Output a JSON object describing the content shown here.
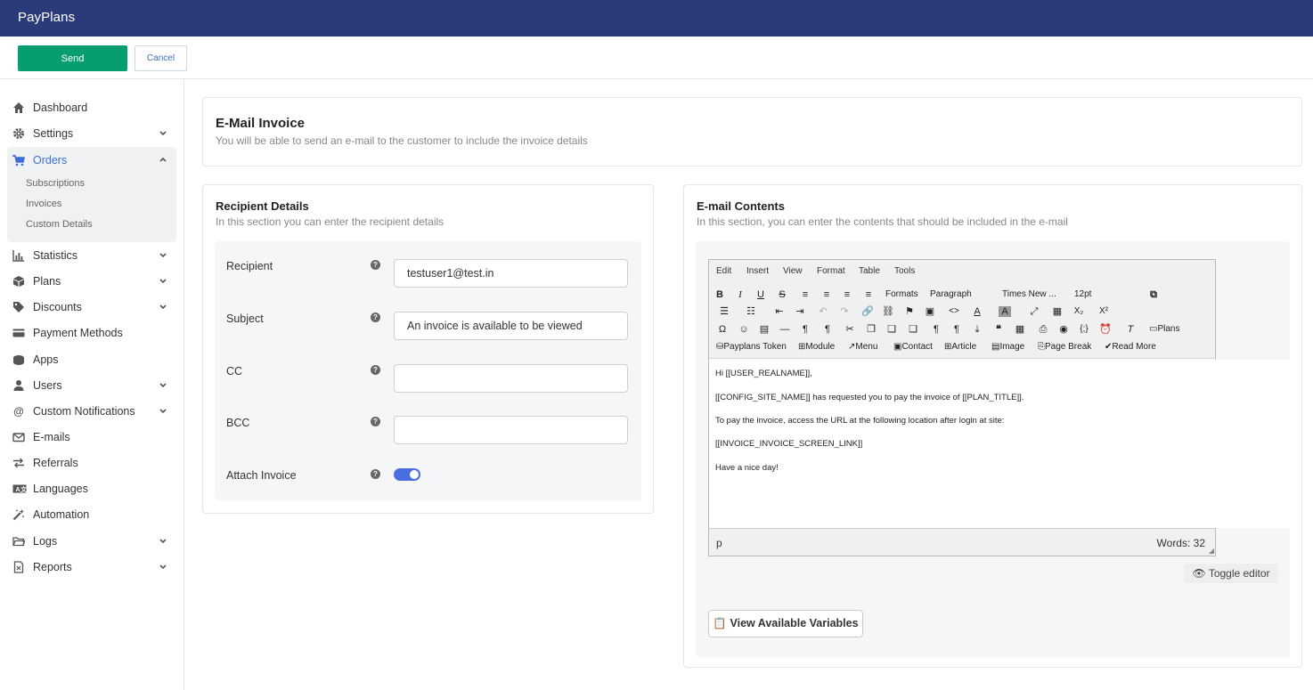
{
  "app": {
    "title": "PayPlans"
  },
  "actions": {
    "send_label": "Send",
    "cancel_label": "Cancel"
  },
  "sidebar": {
    "items": [
      {
        "label": "Dashboard",
        "icon": "home-icon"
      },
      {
        "label": "Settings",
        "icon": "gear-icon"
      },
      {
        "label": "Orders",
        "icon": "cart-icon"
      },
      {
        "label": "Statistics",
        "icon": "bar-chart-icon"
      },
      {
        "label": "Plans",
        "icon": "boxes-icon"
      },
      {
        "label": "Discounts",
        "icon": "tag-icon"
      },
      {
        "label": "Payment Methods",
        "icon": "credit-card-icon"
      },
      {
        "label": "Apps",
        "icon": "cubes-icon"
      },
      {
        "label": "Users",
        "icon": "user-icon"
      },
      {
        "label": "Custom Notifications",
        "icon": "at-icon"
      },
      {
        "label": "E-mails",
        "icon": "envelope-icon"
      },
      {
        "label": "Referrals",
        "icon": "exchange-icon"
      },
      {
        "label": "Languages",
        "icon": "language-icon"
      },
      {
        "label": "Automation",
        "icon": "magic-icon"
      },
      {
        "label": "Logs",
        "icon": "folder-icon"
      },
      {
        "label": "Reports",
        "icon": "file-excel-icon"
      }
    ],
    "orders_sub": [
      "Subscriptions",
      "Invoices",
      "Custom Details"
    ]
  },
  "header_card": {
    "title": "E-Mail Invoice",
    "subtitle": "You will be able to send an e-mail to the customer to include the invoice details"
  },
  "recipient": {
    "title": "Recipient Details",
    "subtitle": "In this section you can enter the recipient details",
    "recipient_label": "Recipient",
    "recipient_value": "testuser1@test.in",
    "subject_label": "Subject",
    "subject_value": "An invoice is available to be viewed",
    "cc_label": "CC",
    "cc_value": "",
    "bcc_label": "BCC",
    "bcc_value": "",
    "attach_label": "Attach Invoice",
    "attach_enabled": true
  },
  "contents": {
    "title": "E-mail Contents",
    "subtitle": "In this section, you can enter the contents that should be included in the e-mail",
    "menu": [
      "Edit",
      "Insert",
      "View",
      "Format",
      "Table",
      "Tools"
    ],
    "toolbar": {
      "formats": "Formats",
      "paragraph": "Paragraph",
      "font": "Times New ...",
      "size": "12pt",
      "plans": "Plans",
      "token": "Payplans Token",
      "module": "Module",
      "menu": "Menu",
      "contact": "Contact",
      "article": "Article",
      "image": "Image",
      "page_break": "Page Break",
      "read_more": "Read More"
    },
    "body_lines": [
      "Hi [[USER_REALNAME]],",
      "[[CONFIG_SITE_NAME]] has requested you to pay the invoice of [[PLAN_TITLE]].",
      "To pay the invoice, access the URL at the following location after login at site:",
      "[[INVOICE_INVOICE_SCREEN_LINK]]",
      "Have a nice day!"
    ],
    "status_path": "p",
    "word_count": "Words: 32",
    "toggle_label": "Toggle editor",
    "vars_label": "View Available Variables"
  }
}
